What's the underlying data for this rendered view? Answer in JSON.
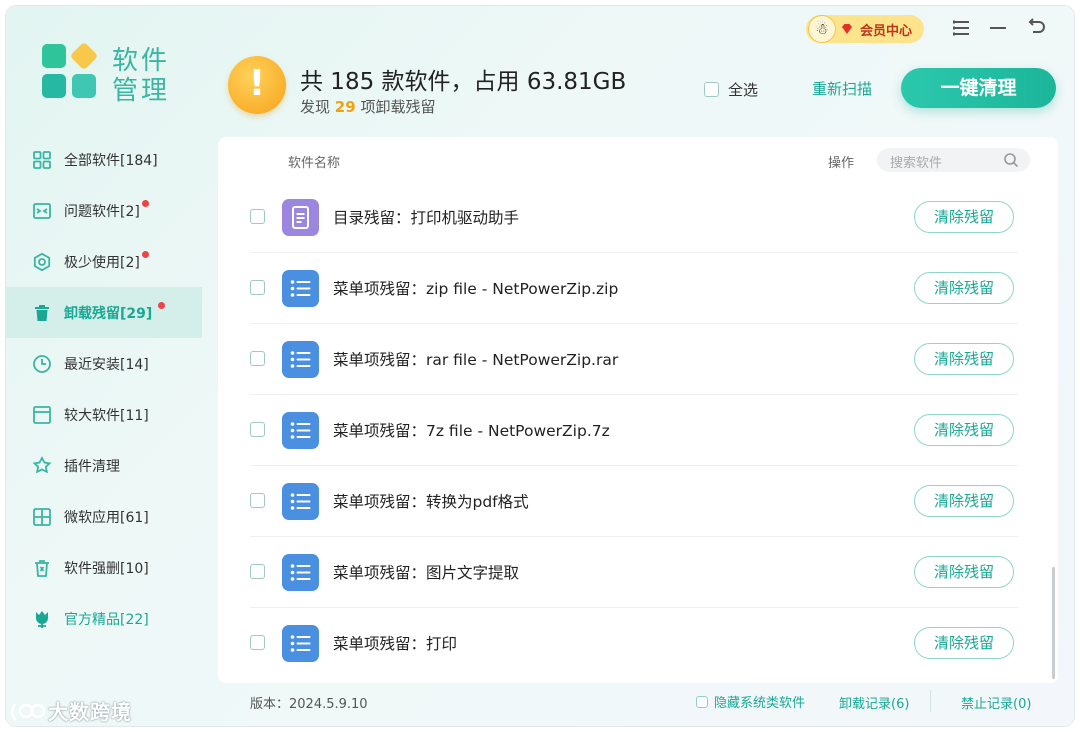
{
  "app": {
    "title_line1": "软件",
    "title_line2": "管理"
  },
  "vip": {
    "label": "会员中心"
  },
  "header": {
    "summary": "共 185 款软件，占用 63.81GB",
    "sub_prefix": "发现",
    "sub_count": "29",
    "sub_suffix": "项卸载残留",
    "select_all": "全选",
    "rescan": "重新扫描",
    "one_click": "一键清理"
  },
  "sidebar": {
    "items": [
      {
        "label": "全部软件[184]",
        "icon": "grid-icon"
      },
      {
        "label": "问题软件[2]",
        "icon": "window-warning-icon",
        "dot": true
      },
      {
        "label": "极少使用[2]",
        "icon": "hexagon-icon",
        "dot": true
      },
      {
        "label": "卸载残留[29]",
        "icon": "trash-icon",
        "dot": true,
        "active": true
      },
      {
        "label": "最近安装[14]",
        "icon": "clock-icon"
      },
      {
        "label": "较大软件[11]",
        "icon": "window-icon"
      },
      {
        "label": "插件清理",
        "icon": "puzzle-icon"
      },
      {
        "label": "微软应用[61]",
        "icon": "windows-icon"
      },
      {
        "label": "软件强删[10]",
        "icon": "force-delete-icon"
      },
      {
        "label": "官方精品[22]",
        "icon": "tulip-icon"
      }
    ]
  },
  "table": {
    "col_name": "软件名称",
    "col_op": "操作",
    "search_placeholder": "搜索软件",
    "rows": [
      {
        "name": "目录残留：打印机驱动助手",
        "icon": "document-icon",
        "action": "清除残留"
      },
      {
        "name": "菜单项残留：zip file - NetPowerZip.zip",
        "icon": "list-icon",
        "action": "清除残留"
      },
      {
        "name": "菜单项残留：rar file - NetPowerZip.rar",
        "icon": "list-icon",
        "action": "清除残留"
      },
      {
        "name": "菜单项残留：7z file - NetPowerZip.7z",
        "icon": "list-icon",
        "action": "清除残留"
      },
      {
        "name": "菜单项残留：转换为pdf格式",
        "icon": "list-icon",
        "action": "清除残留"
      },
      {
        "name": "菜单项残留：图片文字提取",
        "icon": "list-icon",
        "action": "清除残留"
      },
      {
        "name": "菜单项残留：打印",
        "icon": "list-icon",
        "action": "清除残留"
      }
    ]
  },
  "footer": {
    "version": "版本：2024.5.9.10",
    "hide_system": "隐藏系统类软件",
    "uninstall_log": "卸载记录(6)",
    "ban_log": "禁止记录(0)"
  },
  "watermark": {
    "text": "大数跨境"
  },
  "colors": {
    "accent": "#1aa894",
    "warning": "#f6a21a",
    "dot": "#f04343",
    "list_icon": "#4a8fe0",
    "doc_icon": "#9b87e0"
  }
}
